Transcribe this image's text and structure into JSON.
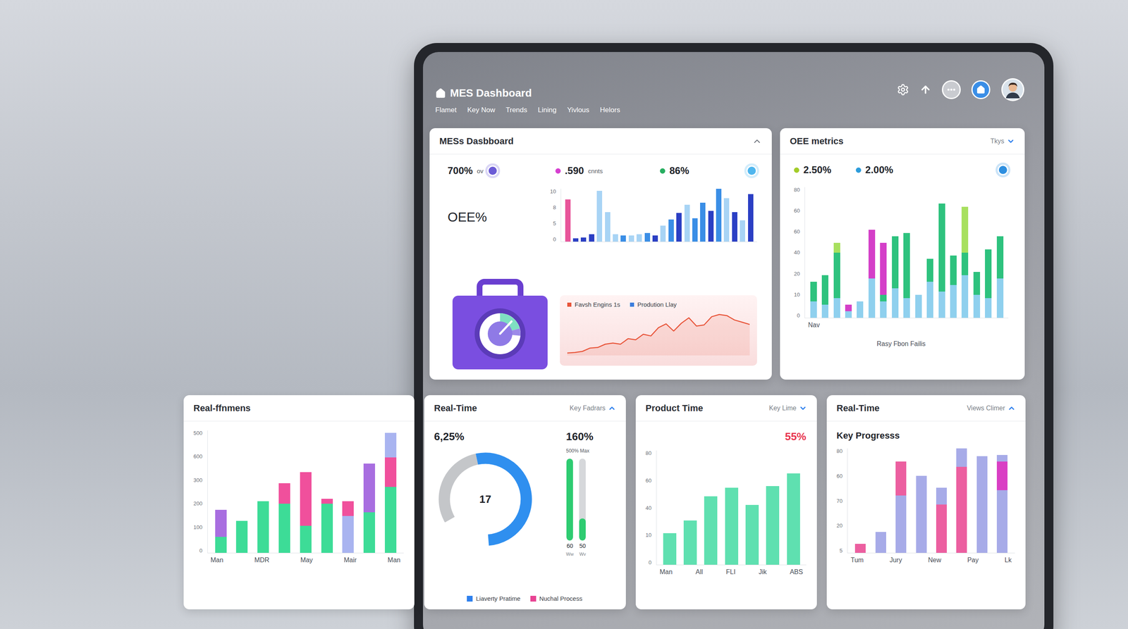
{
  "header": {
    "title": "MES Dashboard",
    "nav": [
      "Flamet",
      "Key Now",
      "Trends",
      "Lining",
      "Yivlous",
      "Helors"
    ]
  },
  "mes_card": {
    "title": "MESs Dasbboard",
    "expanded": true,
    "stats": [
      {
        "kind": "ring-after",
        "value": "700%",
        "unit": "ov",
        "color": "#6b5bd6"
      },
      {
        "kind": "dot-before",
        "value": ".590",
        "unit": "cnnts",
        "color": "#d63fd0"
      },
      {
        "kind": "dot-before",
        "value": "86%",
        "color": "#27ae60"
      },
      {
        "kind": "ring",
        "color": "#4fb6ee"
      }
    ],
    "metric_label": "OEE%",
    "bar_chart": {
      "ticks": [
        "10",
        "8",
        "5",
        "0"
      ],
      "bars": [
        {
          "value": 8,
          "color": "#e8559a"
        },
        {
          "value": 0.6,
          "color": "#2b3fc4"
        },
        {
          "value": 0.8,
          "color": "#2b3fc4"
        },
        {
          "value": 1.4,
          "color": "#2b3fc4"
        },
        {
          "value": 9.6,
          "color": "#a8d4f5"
        },
        {
          "value": 5.6,
          "color": "#a8d4f5"
        },
        {
          "value": 1.4,
          "color": "#a8d4f5"
        },
        {
          "value": 1.2,
          "color": "#3a8ee6"
        },
        {
          "value": 1.2,
          "color": "#a8d4f5"
        },
        {
          "value": 1.4,
          "color": "#a8d4f5"
        },
        {
          "value": 1.6,
          "color": "#3a8ee6"
        },
        {
          "value": 1.2,
          "color": "#2b3fc4"
        },
        {
          "value": 3,
          "color": "#a8d4f5"
        },
        {
          "value": 4.2,
          "color": "#3a8ee6"
        },
        {
          "value": 5.4,
          "color": "#2b3fc4"
        },
        {
          "value": 7,
          "color": "#a8d4f5"
        },
        {
          "value": 4.4,
          "color": "#3a8ee6"
        },
        {
          "value": 7.4,
          "color": "#3a8ee6"
        },
        {
          "value": 5.8,
          "color": "#2b3fc4"
        },
        {
          "value": 10,
          "color": "#3a8ee6"
        },
        {
          "value": 8.2,
          "color": "#a8d4f5"
        },
        {
          "value": 5.6,
          "color": "#2b3fc4"
        },
        {
          "value": 4,
          "color": "#a8d4f5"
        },
        {
          "value": 9,
          "color": "#2b3fc4"
        }
      ]
    },
    "line_chart": {
      "legend": [
        {
          "label": "Favsh Engins 1s",
          "color": "#e8553a"
        },
        {
          "label": "Prodution Llay",
          "color": "#3b7ddd"
        }
      ],
      "values": [
        1.0,
        1.1,
        1.3,
        1.9,
        2.0,
        2.6,
        2.8,
        2.6,
        3.6,
        3.4,
        4.4,
        4.1,
        5.6,
        6.3,
        5.0,
        6.4,
        7.4,
        5.9,
        6.1,
        7.6,
        8.0,
        7.8,
        7.0,
        6.6,
        6.2
      ]
    }
  },
  "oee_card": {
    "title": "OEE metrics",
    "filter": "Tkys",
    "expanded": false,
    "stats": [
      {
        "kind": "dot-before",
        "value": "2.50%",
        "color": "#a3cc29"
      },
      {
        "kind": "dot-before",
        "value": "2.00%",
        "color": "#2d9cdb"
      },
      {
        "kind": "ring",
        "color": "#2d8fe0"
      }
    ],
    "chart": {
      "ticks": [
        "80",
        "60",
        "60",
        "40",
        "20",
        "10",
        "0"
      ],
      "x_label": "Nav",
      "caption": "Rasy Fbon Failis",
      "bars": [
        {
          "segments": [
            {
              "value": 10,
              "color": "#8fd0ee"
            },
            {
              "value": 12,
              "color": "#2ec27e"
            }
          ]
        },
        {
          "segments": [
            {
              "value": 8,
              "color": "#8fd0ee"
            },
            {
              "value": 18,
              "color": "#2ec27e"
            }
          ]
        },
        {
          "segments": [
            {
              "value": 12,
              "color": "#8fd0ee"
            },
            {
              "value": 28,
              "color": "#2ec27e"
            },
            {
              "value": 6,
              "color": "#a8e05f"
            }
          ]
        },
        {
          "segments": [
            {
              "value": 4,
              "color": "#8fd0ee"
            },
            {
              "value": 4,
              "color": "#d43fc8"
            }
          ]
        },
        {
          "segments": [
            {
              "value": 10,
              "color": "#8fd0ee"
            }
          ]
        },
        {
          "segments": [
            {
              "value": 24,
              "color": "#8fd0ee"
            },
            {
              "value": 30,
              "color": "#d43fc8"
            }
          ]
        },
        {
          "segments": [
            {
              "value": 10,
              "color": "#8fd0ee"
            },
            {
              "value": 4,
              "color": "#2ec27e"
            },
            {
              "value": 32,
              "color": "#d43fc8"
            }
          ]
        },
        {
          "segments": [
            {
              "value": 18,
              "color": "#8fd0ee"
            },
            {
              "value": 32,
              "color": "#2ec27e"
            }
          ]
        },
        {
          "segments": [
            {
              "value": 12,
              "color": "#8fd0ee"
            },
            {
              "value": 40,
              "color": "#2ec27e"
            }
          ]
        },
        {
          "segments": [
            {
              "value": 14,
              "color": "#8fd0ee"
            }
          ]
        },
        {
          "segments": [
            {
              "value": 22,
              "color": "#8fd0ee"
            },
            {
              "value": 14,
              "color": "#2ec27e"
            }
          ]
        },
        {
          "segments": [
            {
              "value": 16,
              "color": "#8fd0ee"
            },
            {
              "value": 54,
              "color": "#2ec27e"
            }
          ]
        },
        {
          "segments": [
            {
              "value": 20,
              "color": "#8fd0ee"
            },
            {
              "value": 18,
              "color": "#2ec27e"
            }
          ]
        },
        {
          "segments": [
            {
              "value": 26,
              "color": "#8fd0ee"
            },
            {
              "value": 14,
              "color": "#2ec27e"
            },
            {
              "value": 28,
              "color": "#a8e05f"
            }
          ]
        },
        {
          "segments": [
            {
              "value": 14,
              "color": "#8fd0ee"
            },
            {
              "value": 14,
              "color": "#2ec27e"
            }
          ]
        },
        {
          "segments": [
            {
              "value": 12,
              "color": "#8fd0ee"
            },
            {
              "value": 30,
              "color": "#2ec27e"
            }
          ]
        },
        {
          "segments": [
            {
              "value": 24,
              "color": "#8fd0ee"
            },
            {
              "value": 26,
              "color": "#2ec27e"
            }
          ]
        }
      ]
    }
  },
  "bottom_cards": [
    {
      "kind": "stacked-bars",
      "title": "Real-ffnmens",
      "ticks": [
        "500",
        "600",
        "300",
        "200",
        "100",
        "0"
      ],
      "x_labels": [
        "Man",
        "MDR",
        "May",
        "Mair",
        "Man"
      ],
      "bars": [
        {
          "segments": [
            {
              "value": 65,
              "color": "#3ddc97"
            },
            {
              "value": 110,
              "color": "#a86ee0"
            }
          ]
        },
        {
          "segments": [
            {
              "value": 130,
              "color": "#3ddc97"
            }
          ]
        },
        {
          "segments": [
            {
              "value": 210,
              "color": "#3ddc97"
            }
          ]
        },
        {
          "segments": [
            {
              "value": 200,
              "color": "#3ddc97"
            },
            {
              "value": 85,
              "color": "#f0509c"
            }
          ]
        },
        {
          "segments": [
            {
              "value": 110,
              "color": "#3ddc97"
            },
            {
              "value": 220,
              "color": "#f0509c"
            }
          ]
        },
        {
          "segments": [
            {
              "value": 200,
              "color": "#3ddc97"
            },
            {
              "value": 20,
              "color": "#f0509c"
            }
          ]
        },
        {
          "segments": [
            {
              "value": 150,
              "color": "#a9b4f0"
            },
            {
              "value": 60,
              "color": "#f0509c"
            }
          ]
        },
        {
          "segments": [
            {
              "value": 165,
              "color": "#3ddc97"
            },
            {
              "value": 200,
              "color": "#a86ee0"
            }
          ]
        },
        {
          "segments": [
            {
              "value": 270,
              "color": "#3ddc97"
            },
            {
              "value": 120,
              "color": "#f0509c"
            },
            {
              "value": 100,
              "color": "#a9b4f0"
            }
          ]
        }
      ]
    },
    {
      "kind": "gauge",
      "title": "Real-Time",
      "control": "Key Fadrars",
      "expanded": true,
      "left_value": "6,25%",
      "right_value": "160%",
      "donut": {
        "value": "17",
        "segments": [
          {
            "level": 0.3,
            "color": "#c4c6c9"
          },
          {
            "level": 0.52,
            "color": "#2f8fef"
          }
        ]
      },
      "meter_caption": "500% Max",
      "meters": [
        {
          "level": 1,
          "label": "60",
          "sub": "Ww"
        },
        {
          "level": 0.27,
          "label": "50",
          "sub": "Wv"
        }
      ],
      "legend": [
        {
          "label": "Liaverty Pratime",
          "color": "#2f80ed"
        },
        {
          "label": "Nuchal Process",
          "color": "#e84393"
        }
      ]
    },
    {
      "kind": "bars",
      "title": "Product Time",
      "control": "Key Lime",
      "expanded": false,
      "highlight": "55%",
      "ticks": [
        "80",
        "60",
        "40",
        "10",
        "0"
      ],
      "x_labels": [
        "Man",
        "All",
        "FLI",
        "Jik",
        "ABS"
      ],
      "values": [
        22,
        31,
        48,
        54,
        42,
        55,
        64
      ]
    },
    {
      "kind": "progress",
      "title": "Real-Time",
      "control": "Views Climer",
      "expanded": true,
      "subtitle": "Key Progresss",
      "ticks": [
        "80",
        "60",
        "70",
        "20",
        "5"
      ],
      "x_labels": [
        "Tum",
        "Jury",
        "New",
        "Pay",
        "Lk"
      ],
      "bars": [
        {
          "segments": [
            {
              "value": 7,
              "color": "#ec5fa0"
            }
          ]
        },
        {
          "segments": [
            {
              "value": 16,
              "color": "#a7abe8"
            }
          ]
        },
        {
          "segments": [
            {
              "value": 44,
              "color": "#a7abe8"
            },
            {
              "value": 26,
              "color": "#ec5fa0"
            }
          ]
        },
        {
          "segments": [
            {
              "value": 59,
              "color": "#a7abe8"
            }
          ]
        },
        {
          "segments": [
            {
              "value": 37,
              "color": "#ec5fa0"
            },
            {
              "value": 13,
              "color": "#a7abe8"
            }
          ]
        },
        {
          "segments": [
            {
              "value": 66,
              "color": "#ec5fa0"
            },
            {
              "value": 14,
              "color": "#a7abe8"
            }
          ]
        },
        {
          "segments": [
            {
              "value": 74,
              "color": "#a7abe8"
            }
          ]
        },
        {
          "segments": [
            {
              "value": 48,
              "color": "#a7abe8"
            },
            {
              "value": 22,
              "color": "#d93fc4"
            },
            {
              "value": 5,
              "color": "#a7abe8"
            }
          ]
        }
      ]
    }
  ]
}
